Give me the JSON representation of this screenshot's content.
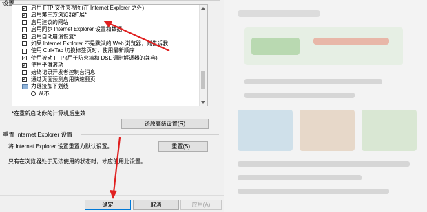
{
  "section_label": "设置",
  "settings": [
    {
      "label": "启用 FTP 文件夹视图(在 Internet Explorer 之外)",
      "checked": true
    },
    {
      "label": "启用第三方浏览器扩展*",
      "checked": true
    },
    {
      "label": "启用建议的网站",
      "checked": false
    },
    {
      "label": "启用同步 Internet Explorer 设置和数据",
      "checked": false
    },
    {
      "label": "启用自动崩溃恢复*",
      "checked": true
    },
    {
      "label": "如果 Internet Explorer 不是默认的 Web 浏览器，则告诉我",
      "checked": false
    },
    {
      "label": "使用 Ctrl+Tab 切换标签页时，使用最新顺序",
      "checked": false
    },
    {
      "label": "使用被动 FTP (用于防火墙和 DSL 调制解调器的兼容)",
      "checked": true
    },
    {
      "label": "使用平滑滚动",
      "checked": true
    },
    {
      "label": "始终记录开发者控制台消息",
      "checked": false
    },
    {
      "label": "通过页面预测启用快速翻页",
      "checked": true
    }
  ],
  "group_label": "为链接加下划线",
  "radio_option": "从不",
  "restart_note": "*在重新启动你的计算机后生效",
  "restore_button": "还原高级设置(R)",
  "reset_section_title": "重置 Internet Explorer 设置",
  "reset_description": "将 Internet Explorer 设置重置为默认设置。",
  "reset_button": "重置(S)...",
  "reset_note": "只有在浏览器处于无法使用的状态时，才应使用此设置。",
  "ok_button": "确定",
  "cancel_button": "取消",
  "apply_button": "应用(A)",
  "colors": {
    "annotation_red": "#e02020",
    "accent": "#0078d7"
  }
}
